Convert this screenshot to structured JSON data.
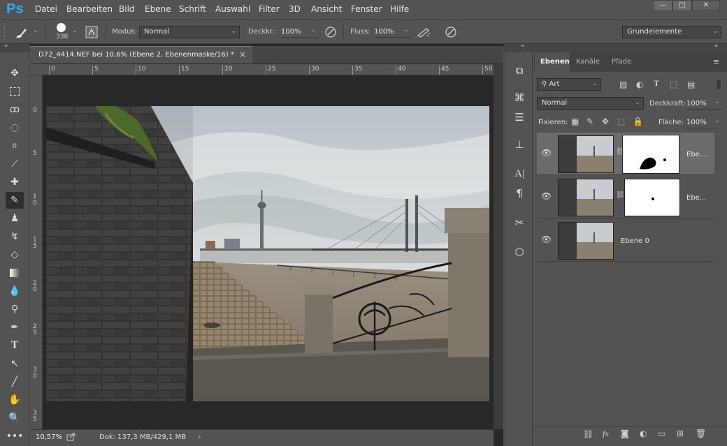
{
  "app": {
    "logo": "Ps"
  },
  "menu": [
    "Datei",
    "Bearbeiten",
    "Bild",
    "Ebene",
    "Schrift",
    "Auswahl",
    "Filter",
    "3D",
    "Ansicht",
    "Fenster",
    "Hilfe"
  ],
  "window_controls": {
    "minimize": "—",
    "maximize": "□",
    "close": "✕"
  },
  "options": {
    "brush_size": "338",
    "mode_label": "Modus:",
    "mode_value": "Normal",
    "opacity_label": "Deckkr.:",
    "opacity_value": "100%",
    "flow_label": "Fluss:",
    "flow_value": "100%",
    "workspace": "Grundelemente"
  },
  "document": {
    "tab_title": "D72_4414.NEF bei 10,6% (Ebene 2, Ebenenmaske/16) *",
    "close": "×",
    "ruler_h": [
      "0",
      "5",
      "10",
      "15",
      "20",
      "25",
      "30",
      "35",
      "40",
      "45",
      "50"
    ],
    "ruler_v": [
      "0",
      "5",
      "1 0",
      "1 5",
      "2 0",
      "2 5",
      "3 0",
      "3 5"
    ],
    "zoom": "10,57%",
    "doc_info": "Dok: 137,3 MB/429,1 MB",
    "status_arrow": "›"
  },
  "layers_panel": {
    "tabs": [
      "Ebenen",
      "Kanäle",
      "Pfade"
    ],
    "filter_value": "Art",
    "blend_mode": "Normal",
    "opacity_label": "Deckkraft:",
    "opacity_value": "100%",
    "lock_label": "Fixieren:",
    "fill_label": "Fläche:",
    "fill_value": "100%",
    "layers": [
      {
        "name": "Ebe...",
        "has_mask": true,
        "selected": true
      },
      {
        "name": "Ebe...",
        "has_mask": true,
        "selected": false
      },
      {
        "name": "Ebene 0",
        "has_mask": false,
        "selected": false
      }
    ],
    "footer_icons": [
      "link-icon",
      "fx-icon",
      "mask-icon",
      "adjustment-icon",
      "folder-icon",
      "new-layer-icon",
      "trash-icon"
    ]
  },
  "colors": {
    "accent": "#31a8ff",
    "panel_bg": "#535353",
    "canvas_bg": "#282828"
  }
}
